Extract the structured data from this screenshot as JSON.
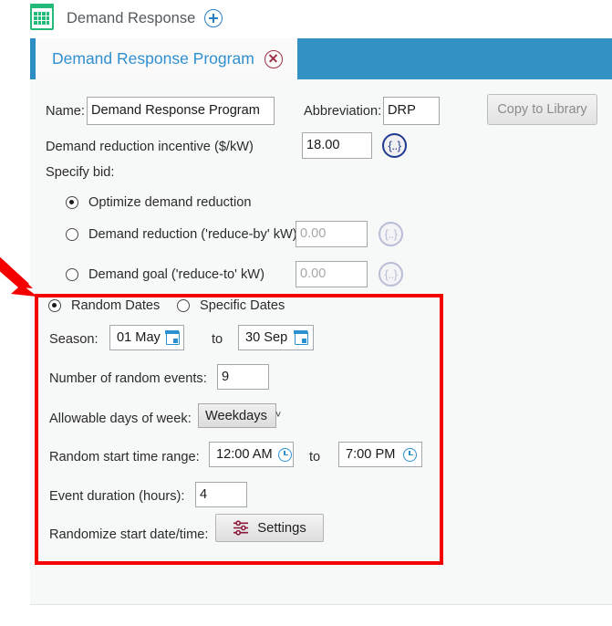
{
  "header": {
    "icon": "calendar-icon",
    "title": "Demand Response",
    "add_icon": "plus-circle-icon"
  },
  "tab": {
    "label": "Demand Response Program",
    "close_icon": "close-circle-icon"
  },
  "form": {
    "name_label": "Name:",
    "name_value": "Demand Response Program",
    "abbreviation_label": "Abbreviation:",
    "abbreviation_value": "DRP",
    "copy_to_library_label": "Copy to Library",
    "incentive_label": "Demand reduction incentive ($/kW)",
    "incentive_value": "18.00",
    "braces_label": "{..}"
  },
  "bid": {
    "section_label": "Specify bid:",
    "options": [
      {
        "label": "Optimize demand reduction",
        "selected": true,
        "value": null
      },
      {
        "label": "Demand reduction ('reduce-by' kW)",
        "selected": false,
        "value": "0.00"
      },
      {
        "label": "Demand goal ('reduce-to' kW)",
        "selected": false,
        "value": "0.00"
      }
    ]
  },
  "dates": {
    "mode_options": [
      {
        "label": "Random Dates",
        "selected": true
      },
      {
        "label": "Specific Dates",
        "selected": false
      }
    ],
    "season_label": "Season:",
    "season_from": "01 May",
    "season_to_label": "to",
    "season_to": "30 Sep",
    "num_events_label": "Number of random events:",
    "num_events_value": "9",
    "days_of_week_label": "Allowable days of week:",
    "days_of_week_value": "Weekdays",
    "start_time_label": "Random start time range:",
    "start_time_from": "12:00 AM",
    "start_time_to_label": "to",
    "start_time_to": "7:00 PM",
    "duration_label": "Event duration (hours):",
    "duration_value": "4",
    "randomize_label": "Randomize start date/time:",
    "settings_button_label": "Settings",
    "settings_icon": "sliders-icon"
  },
  "colors": {
    "tab_bar_blue": "#3391c4",
    "tab_text_blue": "#2f8fd0",
    "calendar_green": "#22bb77",
    "annotation_red": "#f40000",
    "settings_icon_maroon": "#8e1838",
    "icon_blue": "#2a90d0",
    "braces_blue": "#203a8f"
  }
}
